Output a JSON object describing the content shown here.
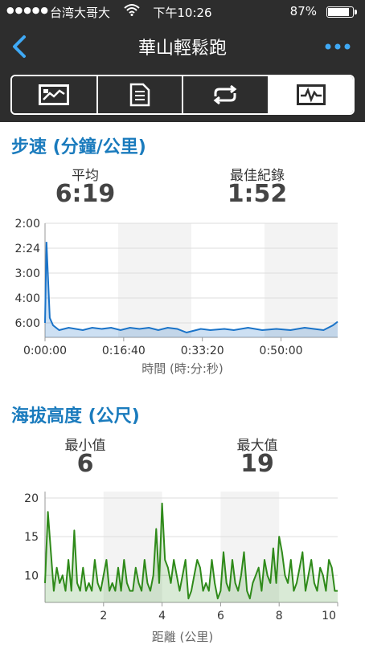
{
  "status_bar": {
    "signal_dots": "●●●●●",
    "carrier": "台湾大哥大",
    "wifi_icon": "wifi-icon",
    "time": "下午10:26",
    "battery_text": "87%",
    "battery_level": 0.87
  },
  "nav": {
    "title": "華山輕鬆跑",
    "back_icon": "chevron-left-icon",
    "more_icon": "more-dots-icon",
    "accent_color": "#3fa9f5"
  },
  "tabs": [
    {
      "icon": "map-icon",
      "active": false
    },
    {
      "icon": "document-list-icon",
      "active": false
    },
    {
      "icon": "repeat-icon",
      "active": false
    },
    {
      "icon": "chart-icon",
      "active": true
    }
  ],
  "pace": {
    "title": "步速 (分鐘/公里)",
    "avg_label": "平均",
    "avg_value": "6:19",
    "best_label": "最佳紀錄",
    "best_value": "1:52",
    "xlabel": "時間 (時:分:秒)"
  },
  "elevation": {
    "title": "海拔高度 (公尺)",
    "min_label": "最小值",
    "min_value": "6",
    "max_label": "最大值",
    "max_value": "19",
    "xlabel": "距離 (公里)"
  },
  "chart_data": [
    {
      "type": "area",
      "title": "步速 (分鐘/公里)",
      "xlabel": "時間 (時:分:秒)",
      "ylabel": "",
      "y_ticks": [
        "2:00",
        "2:24",
        "3:00",
        "4:00",
        "6:00"
      ],
      "x_ticks": [
        "0:00:00",
        "0:16:40",
        "0:33:20",
        "0:50:00"
      ],
      "color": "#1a73c8",
      "x": [
        0,
        0.3,
        1,
        1.7,
        3,
        5,
        8,
        10,
        12,
        14,
        16,
        18,
        20,
        22,
        24,
        26,
        28,
        30,
        32,
        33,
        35,
        38,
        40,
        43,
        46,
        49,
        52,
        55,
        57,
        59,
        61,
        62
      ],
      "values": [
        6.0,
        2.3,
        5.6,
        6.1,
        6.3,
        6.2,
        6.3,
        6.2,
        6.25,
        6.2,
        6.3,
        6.2,
        6.25,
        6.2,
        6.3,
        6.2,
        6.25,
        6.4,
        6.3,
        6.25,
        6.3,
        6.25,
        6.3,
        6.2,
        6.3,
        6.25,
        6.3,
        6.2,
        6.25,
        6.3,
        6.1,
        5.9
      ],
      "x_unit": "minutes",
      "y_unit": "min/km"
    },
    {
      "type": "area",
      "title": "海拔高度 (公尺)",
      "xlabel": "距離 (公里)",
      "ylabel": "",
      "y_ticks": [
        "10",
        "15",
        "20"
      ],
      "x_ticks": [
        "2",
        "4",
        "6",
        "8",
        "10"
      ],
      "color": "#2f8a1a",
      "x": [
        0,
        0.1,
        0.2,
        0.3,
        0.4,
        0.5,
        0.6,
        0.7,
        0.8,
        0.9,
        1.0,
        1.1,
        1.2,
        1.3,
        1.4,
        1.5,
        1.6,
        1.7,
        1.8,
        1.9,
        2.0,
        2.1,
        2.2,
        2.3,
        2.4,
        2.5,
        2.6,
        2.7,
        2.8,
        2.9,
        3.0,
        3.1,
        3.2,
        3.3,
        3.4,
        3.5,
        3.6,
        3.7,
        3.8,
        3.9,
        4.0,
        4.1,
        4.2,
        4.3,
        4.4,
        4.5,
        4.6,
        4.7,
        4.8,
        4.9,
        5.0,
        5.1,
        5.2,
        5.3,
        5.4,
        5.5,
        5.6,
        5.7,
        5.8,
        5.9,
        6.0,
        6.1,
        6.2,
        6.3,
        6.4,
        6.5,
        6.6,
        6.7,
        6.8,
        6.9,
        7.0,
        7.1,
        7.2,
        7.3,
        7.4,
        7.5,
        7.6,
        7.7,
        7.8,
        7.9,
        8.0,
        8.1,
        8.2,
        8.3,
        8.4,
        8.5,
        8.6,
        8.7,
        8.8,
        8.9,
        9.0,
        9.1,
        9.2,
        9.3,
        9.4,
        9.5,
        9.6,
        9.7,
        9.8,
        9.9,
        10.0
      ],
      "values": [
        9,
        18.2,
        13,
        8,
        11,
        9,
        10,
        8,
        12,
        8,
        15.8,
        9,
        8,
        11,
        8,
        9,
        8,
        12,
        9,
        8,
        10,
        12,
        8,
        9,
        8,
        11,
        8,
        12,
        9,
        8,
        8,
        11,
        9,
        8,
        12,
        9,
        8,
        10,
        16,
        9,
        19.3,
        12,
        11,
        9,
        12,
        10,
        8,
        10,
        12,
        7,
        8,
        10,
        12,
        11,
        8,
        9,
        8,
        12,
        9,
        7,
        8,
        13,
        9,
        8,
        12,
        9,
        8,
        10,
        13,
        8,
        7,
        9,
        10,
        11,
        8,
        12,
        10,
        9,
        13.5,
        9,
        15,
        13,
        10,
        9,
        12,
        8,
        9,
        11,
        13,
        8,
        10,
        12,
        9,
        8,
        11,
        10,
        8,
        12,
        11,
        8,
        8
      ],
      "x_unit": "km",
      "y_unit": "m"
    }
  ]
}
